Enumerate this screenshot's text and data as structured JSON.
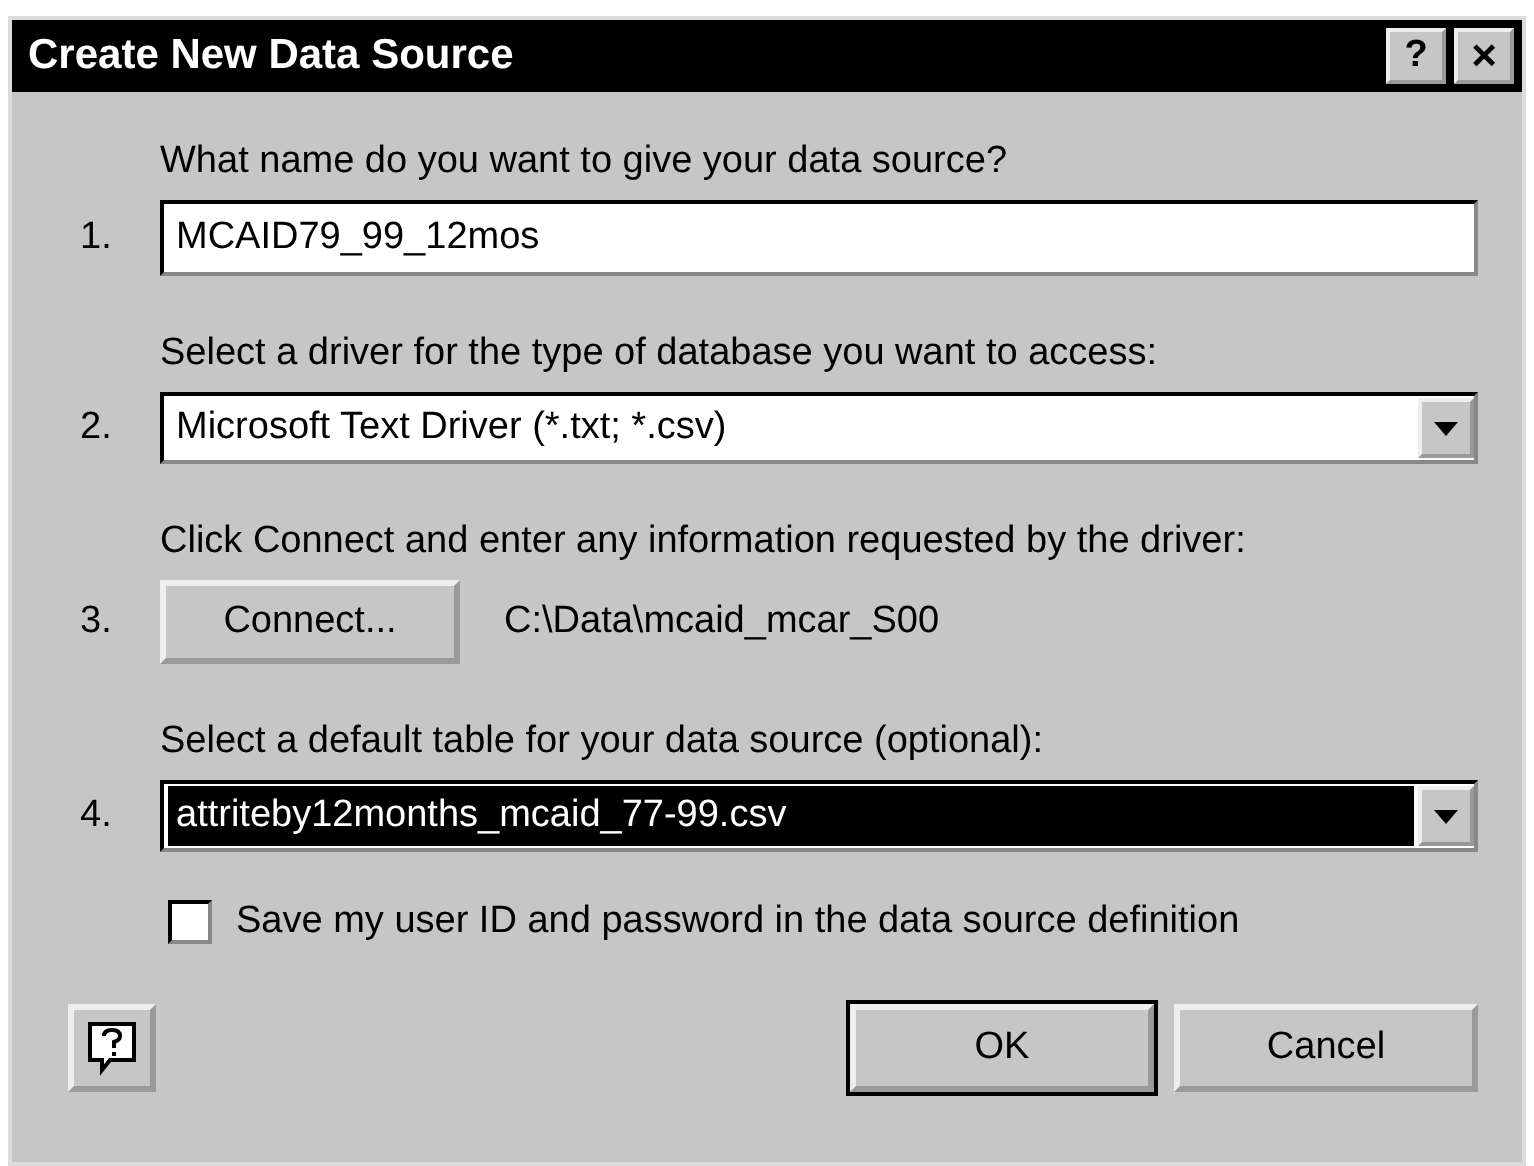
{
  "window": {
    "title": "Create New Data Source",
    "title_buttons": [
      {
        "kind": "help",
        "label": "?"
      },
      {
        "kind": "close",
        "label": "×"
      }
    ]
  },
  "steps": [
    {
      "prompt": "What name do you want to give your data source?",
      "number": "1.",
      "kind": "text",
      "value": "MCAID79_99_12mos"
    },
    {
      "prompt": "Select a driver for the type of database you want to access:",
      "number": "2.",
      "kind": "dropdown",
      "value": "Microsoft Text Driver (*.txt; *.csv)",
      "highlighted": false
    },
    {
      "prompt": "Click Connect and enter any information requested by the driver:",
      "number": "3.",
      "kind": "button",
      "label": "Connect...",
      "value": "C:\\Data\\mcaid_mcar_S00"
    },
    {
      "prompt": "Select a default table for your data source (optional):",
      "number": "4.",
      "kind": "dropdown",
      "value": "attriteby12months_mcaid_77-99.csv",
      "highlighted": true
    }
  ],
  "save_credentials": {
    "label": "Save my user ID and password in the data source definition",
    "checked": false
  },
  "buttons": [
    {
      "label": "OK",
      "default": true
    },
    {
      "label": "Cancel",
      "default": false
    }
  ]
}
